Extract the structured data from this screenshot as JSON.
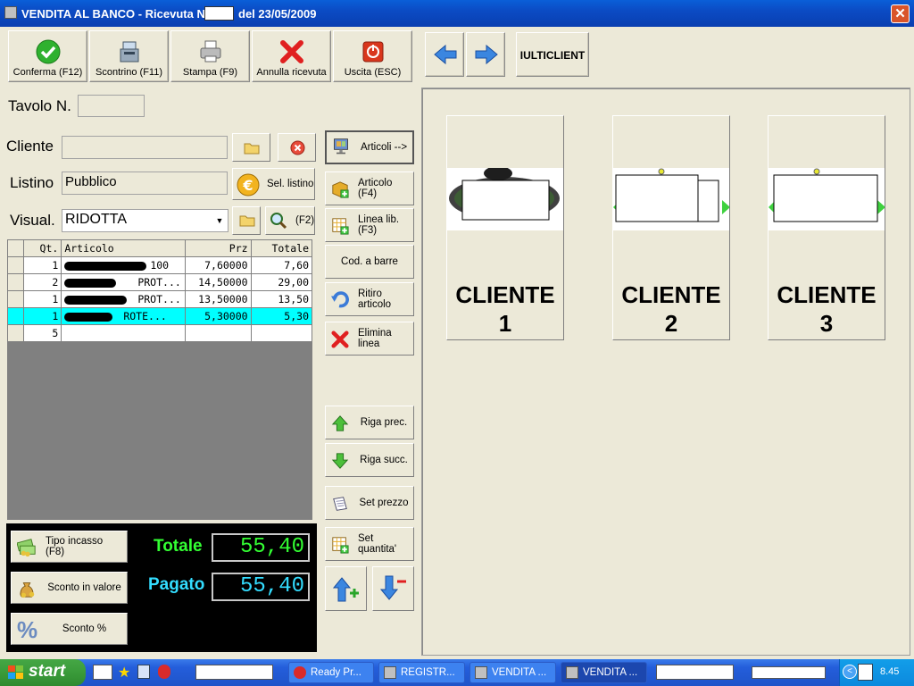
{
  "window": {
    "title_prefix": "VENDITA AL BANCO - Ricevuta N.",
    "title_suffix": "del 23/05/2009",
    "close_icon": "close-icon"
  },
  "toolbar": {
    "confirm": "Conferma (F12)",
    "receipt": "Scontrino (F11)",
    "print": "Stampa (F9)",
    "cancel": "Annulla ricevuta",
    "exit": "Uscita (ESC)",
    "multiclient": "IULTICLIENT"
  },
  "form": {
    "table_label": "Tavolo N.",
    "table_value": "",
    "customer_label": "Cliente",
    "customer_value": "",
    "list_label": "Listino",
    "list_value": "Pubblico",
    "select_list_label": "Sel. listino",
    "view_label": "Visual.",
    "view_value": "RIDOTTA",
    "f2_label": "(F2)"
  },
  "grid": {
    "columns": [
      "Qt.",
      "Articolo",
      "Prz",
      "Totale"
    ],
    "rows": [
      {
        "qty": "1",
        "article": "100",
        "price": "7,60000",
        "total": "7,60"
      },
      {
        "qty": "2",
        "article": "PROT...",
        "price": "14,50000",
        "total": "29,00"
      },
      {
        "qty": "1",
        "article": "PROT...",
        "price": "13,50000",
        "total": "13,50"
      },
      {
        "qty": "1",
        "article": "ROTE...",
        "price": "5,30000",
        "total": "5,30"
      },
      {
        "qty": "5",
        "article": "",
        "price": "",
        "total": ""
      }
    ]
  },
  "side_buttons": {
    "articles_arrow": "Articoli -->",
    "article_f4": "Articolo (F4)",
    "free_line": "Linea lib. (F3)",
    "barcode": "Cod. a barre",
    "return_article": "Ritiro articolo",
    "delete_line": "Elimina linea",
    "prev_row": "Riga prec.",
    "next_row": "Riga succ.",
    "set_price": "Set prezzo",
    "set_quantity": "Set quantita'"
  },
  "totals": {
    "payment_type": "Tipo incasso (F8)",
    "value_discount": "Sconto in valore",
    "percent_discount": "Sconto %",
    "total_label": "Totale",
    "total_value": "55,40",
    "paid_label": "Pagato",
    "paid_value": "55,40"
  },
  "clients": [
    {
      "line1": "CLIENTE",
      "line2": "1"
    },
    {
      "line1": "CLIENTE",
      "line2": "2"
    },
    {
      "line1": "CLIENTE",
      "line2": "3"
    }
  ],
  "taskbar": {
    "start": "start",
    "tasks": [
      "Ready Pr...",
      "REGISTR...",
      "VENDITA ...",
      "VENDITA ..."
    ],
    "clock": "8.45"
  },
  "colors": {
    "accent_green": "#33ff33",
    "accent_cyan": "#33ddff",
    "selection": "#00ffff",
    "titlebar": "#0b4bc4"
  }
}
